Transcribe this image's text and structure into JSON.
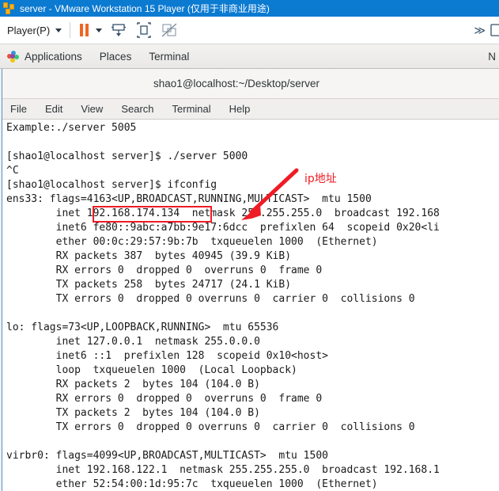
{
  "vmware": {
    "title": "server - VMware Workstation 15 Player (仅用于非商业用途)",
    "app_icon": "vmware-logo-icon",
    "toolbar": {
      "player_menu": "Player(P)",
      "player_mnemonic": "P",
      "pause_label": "Pause",
      "send_ctrl_alt_del_label": "Send Ctrl+Alt+Del",
      "fullscreen_label": "Enter Full Screen",
      "unity_label": "Unity Mode",
      "overflow_label": "≫"
    }
  },
  "gnome_panel": {
    "applications": "Applications",
    "places": "Places",
    "terminal": "Terminal",
    "clock": "N"
  },
  "terminal": {
    "title": "shao1@localhost:~/Desktop/server",
    "menu": [
      "File",
      "Edit",
      "View",
      "Search",
      "Terminal",
      "Help"
    ],
    "lines": [
      "Example:./server 5005",
      "",
      "[shao1@localhost server]$ ./server 5000",
      "^C",
      "[shao1@localhost server]$ ifconfig",
      "ens33: flags=4163<UP,BROADCAST,RUNNING,MULTICAST>  mtu 1500",
      "        inet 192.168.174.134  netmask 255.255.255.0  broadcast 192.168",
      "        inet6 fe80::9abc:a7bb:9e17:6dcc  prefixlen 64  scopeid 0x20<li",
      "        ether 00:0c:29:57:9b:7b  txqueuelen 1000  (Ethernet)",
      "        RX packets 387  bytes 40945 (39.9 KiB)",
      "        RX errors 0  dropped 0  overruns 0  frame 0",
      "        TX packets 258  bytes 24717 (24.1 KiB)",
      "        TX errors 0  dropped 0 overruns 0  carrier 0  collisions 0",
      "",
      "lo: flags=73<UP,LOOPBACK,RUNNING>  mtu 65536",
      "        inet 127.0.0.1  netmask 255.0.0.0",
      "        inet6 ::1  prefixlen 128  scopeid 0x10<host>",
      "        loop  txqueuelen 1000  (Local Loopback)",
      "        RX packets 2  bytes 104 (104.0 B)",
      "        RX errors 0  dropped 0  overruns 0  frame 0",
      "        TX packets 2  bytes 104 (104.0 B)",
      "        TX errors 0  dropped 0 overruns 0  carrier 0  collisions 0",
      "",
      "virbr0: flags=4099<UP,BROADCAST,MULTICAST>  mtu 1500",
      "        inet 192.168.122.1  netmask 255.255.255.0  broadcast 192.168.1",
      "        ether 52:54:00:1d:95:7c  txqueuelen 1000  (Ethernet)"
    ]
  },
  "annotation": {
    "label": "ip地址",
    "color": "#ee1c25",
    "highlighted_value": "192.168.174.134"
  }
}
